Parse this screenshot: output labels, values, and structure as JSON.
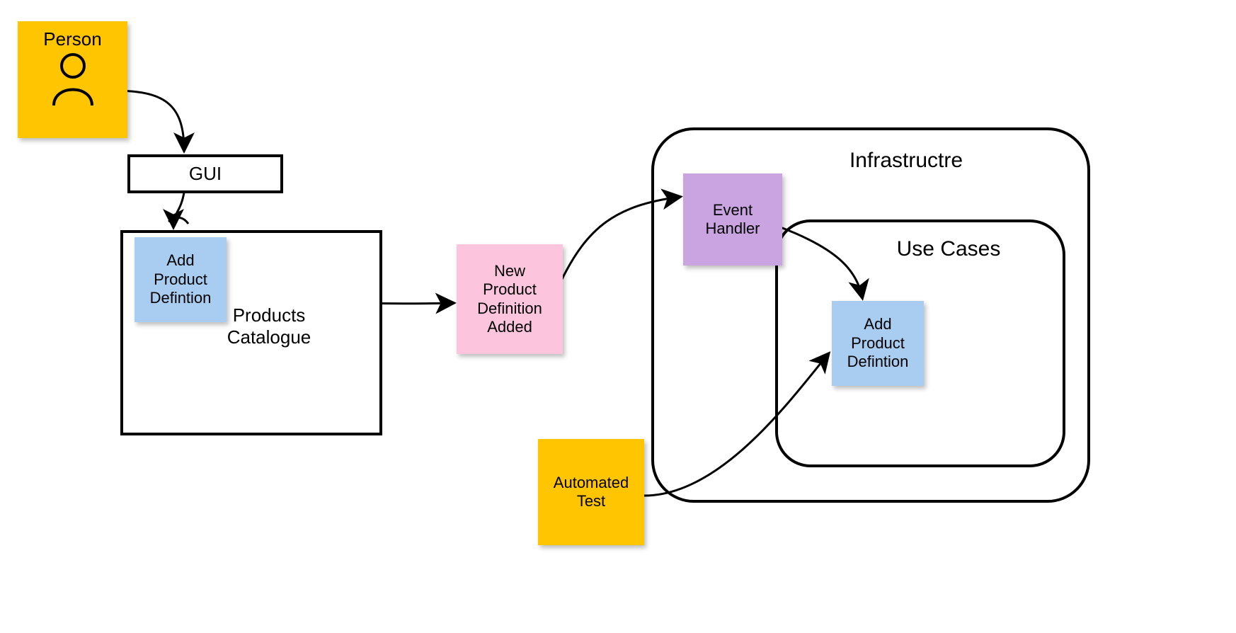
{
  "nodes": {
    "person": {
      "label": "Person"
    },
    "gui": {
      "label": "GUI"
    },
    "add_def_1": {
      "l1": "Add",
      "l2": "Product",
      "l3": "Defintion"
    },
    "catalogue": {
      "l1": "Products",
      "l2": "Catalogue"
    },
    "event": {
      "l1": "New",
      "l2": "Product",
      "l3": "Definition",
      "l4": "Added"
    },
    "handler": {
      "l1": "Event",
      "l2": "Handler"
    },
    "infra": {
      "label": "Infrastructre"
    },
    "usecases": {
      "label": "Use Cases"
    },
    "add_def_2": {
      "l1": "Add",
      "l2": "Product",
      "l3": "Defintion"
    },
    "autotest": {
      "l1": "Automated",
      "l2": "Test"
    }
  },
  "colors": {
    "yellow": "#ffc600",
    "blue": "#a9cdf0",
    "pink": "#fcc5dd",
    "purple": "#c9a4e0"
  }
}
